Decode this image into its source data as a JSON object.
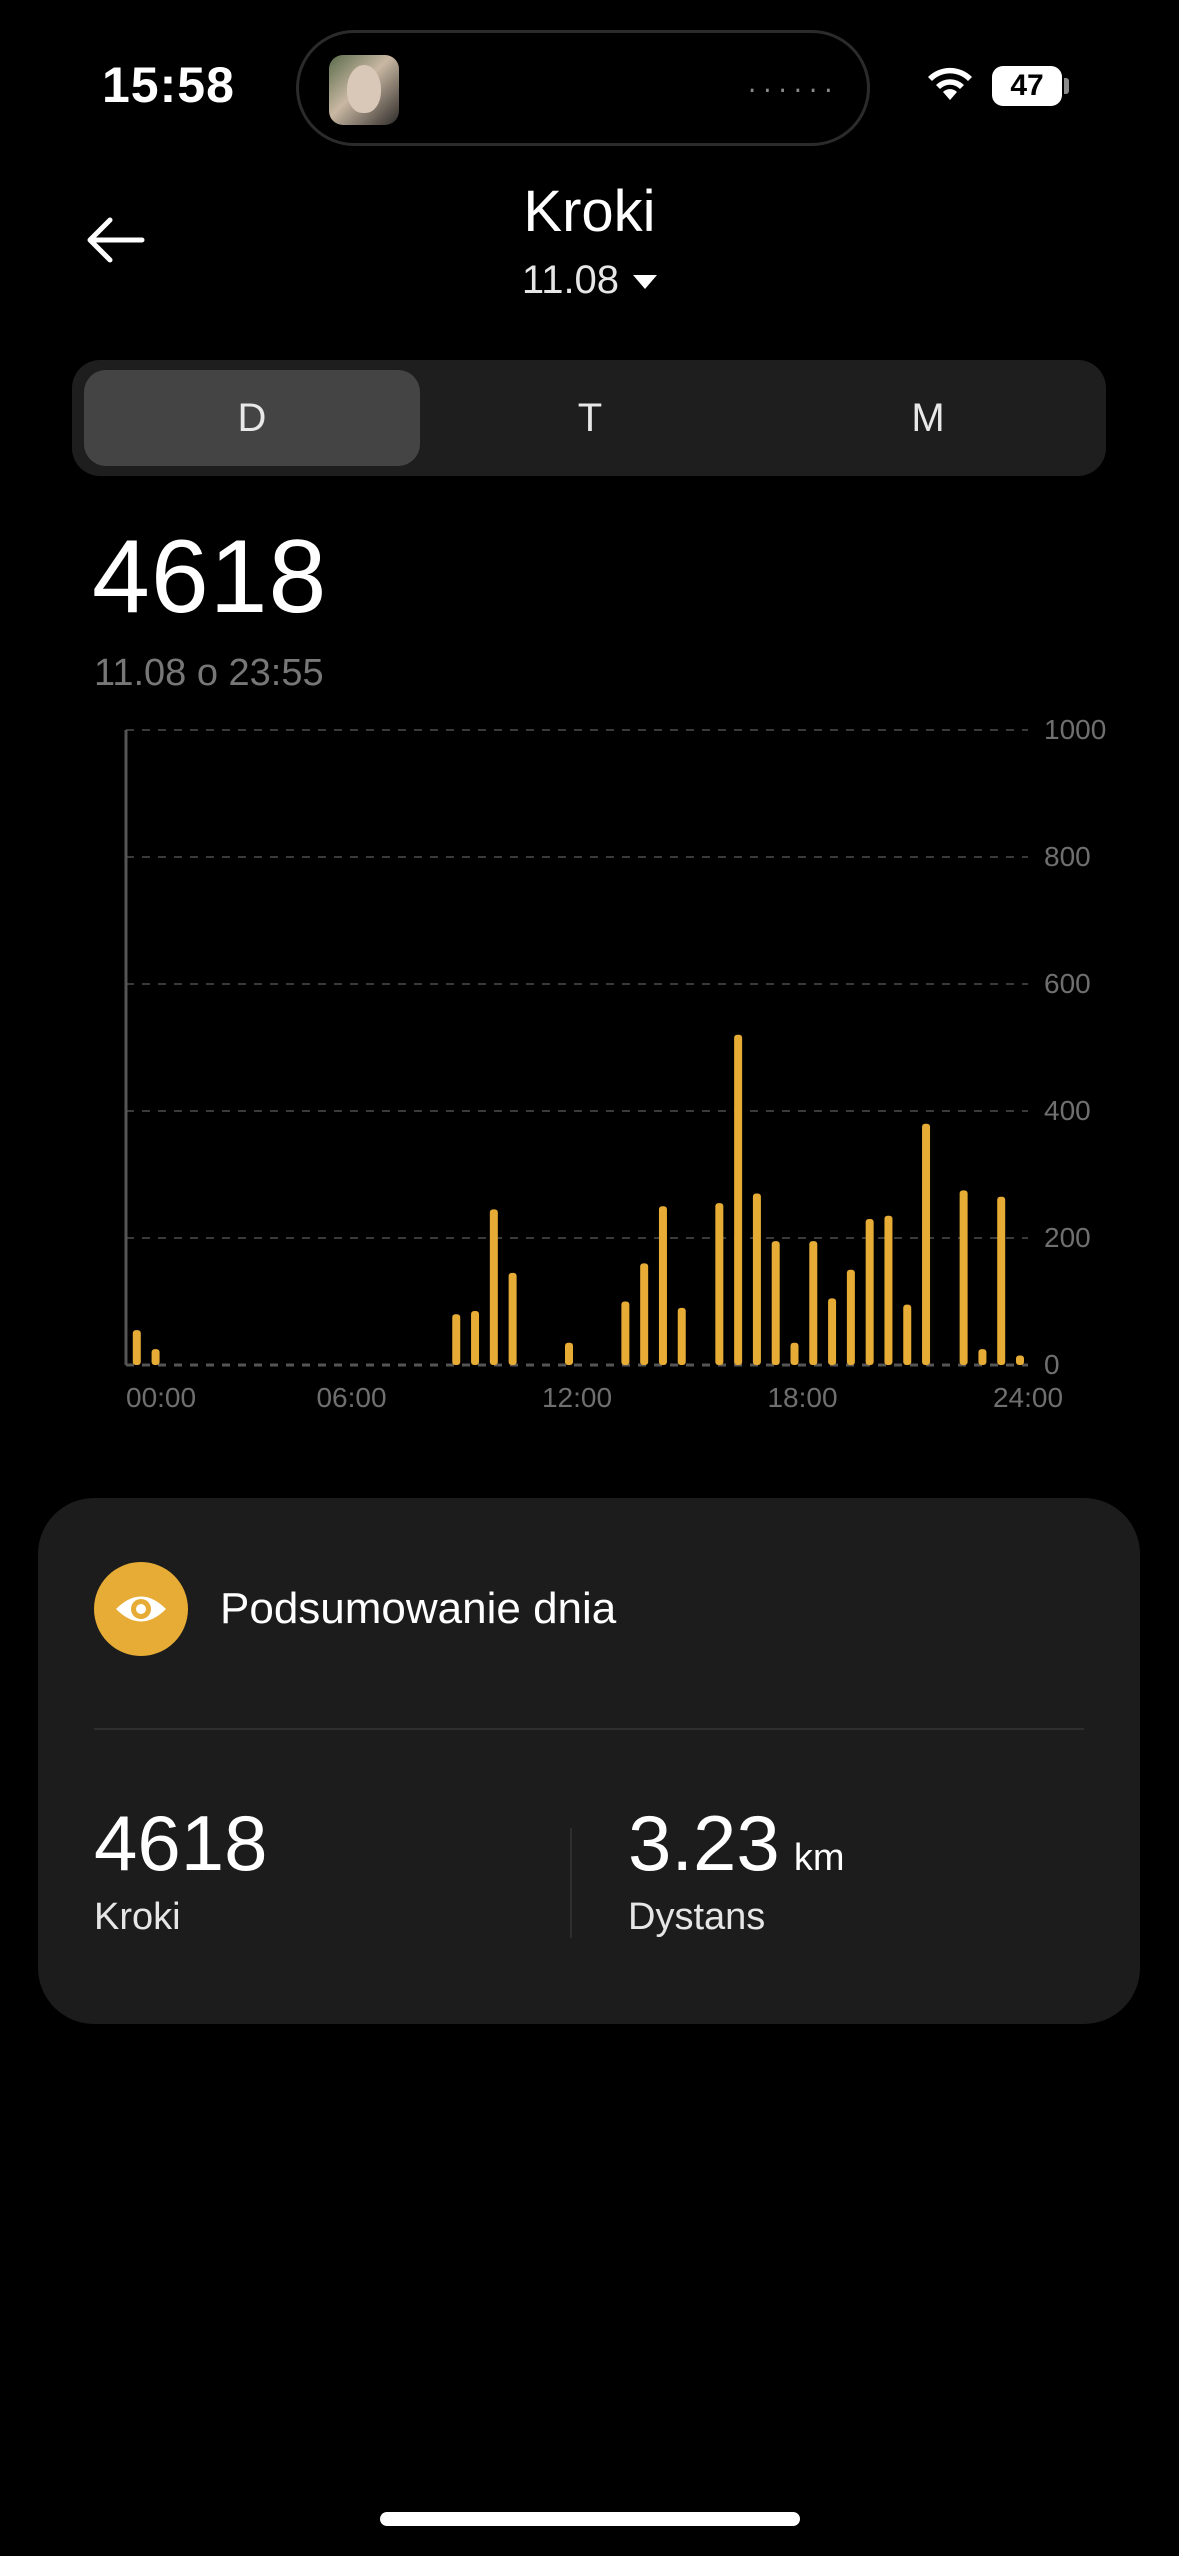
{
  "status": {
    "time": "15:58",
    "battery": "47"
  },
  "header": {
    "title": "Kroki",
    "date": "11.08"
  },
  "segments": [
    {
      "label": "D",
      "active": true
    },
    {
      "label": "T",
      "active": false
    },
    {
      "label": "M",
      "active": false
    }
  ],
  "summary_top": {
    "value": "4618",
    "timestamp": "11.08 o 23:55"
  },
  "colors": {
    "accent": "#e6ac35",
    "background": "#000000",
    "card": "#1c1c1c"
  },
  "chart_data": {
    "type": "bar",
    "title": "",
    "xlabel": "",
    "ylabel": "",
    "x_ticks": [
      "00:00",
      "06:00",
      "12:00",
      "18:00",
      "24:00"
    ],
    "y_ticks": [
      "0",
      "200",
      "400",
      "600",
      "800",
      "1000"
    ],
    "xlim": [
      0,
      24
    ],
    "ylim": [
      0,
      1000
    ],
    "grid": true,
    "y_axis_side": "right",
    "bar_interval_minutes": 30,
    "bars": [
      {
        "x": "00:30",
        "value": 55
      },
      {
        "x": "01:00",
        "value": 25
      },
      {
        "x": "09:00",
        "value": 80
      },
      {
        "x": "09:30",
        "value": 85
      },
      {
        "x": "10:00",
        "value": 245
      },
      {
        "x": "10:30",
        "value": 145
      },
      {
        "x": "12:00",
        "value": 35
      },
      {
        "x": "13:30",
        "value": 100
      },
      {
        "x": "14:00",
        "value": 160
      },
      {
        "x": "14:30",
        "value": 250
      },
      {
        "x": "15:00",
        "value": 90
      },
      {
        "x": "16:00",
        "value": 255
      },
      {
        "x": "16:30",
        "value": 520
      },
      {
        "x": "17:00",
        "value": 270
      },
      {
        "x": "17:30",
        "value": 195
      },
      {
        "x": "18:00",
        "value": 35
      },
      {
        "x": "18:30",
        "value": 195
      },
      {
        "x": "19:00",
        "value": 105
      },
      {
        "x": "19:30",
        "value": 150
      },
      {
        "x": "20:00",
        "value": 230
      },
      {
        "x": "20:30",
        "value": 235
      },
      {
        "x": "21:00",
        "value": 95
      },
      {
        "x": "21:30",
        "value": 380
      },
      {
        "x": "22:30",
        "value": 275
      },
      {
        "x": "23:00",
        "value": 25
      },
      {
        "x": "23:30",
        "value": 265
      },
      {
        "x": "24:00",
        "value": 15
      }
    ]
  },
  "card": {
    "icon": "eye-icon",
    "title": "Podsumowanie dnia",
    "stats": [
      {
        "value": "4618",
        "unit": "",
        "label": "Kroki"
      },
      {
        "value": "3.23",
        "unit": "km",
        "label": "Dystans"
      }
    ]
  }
}
